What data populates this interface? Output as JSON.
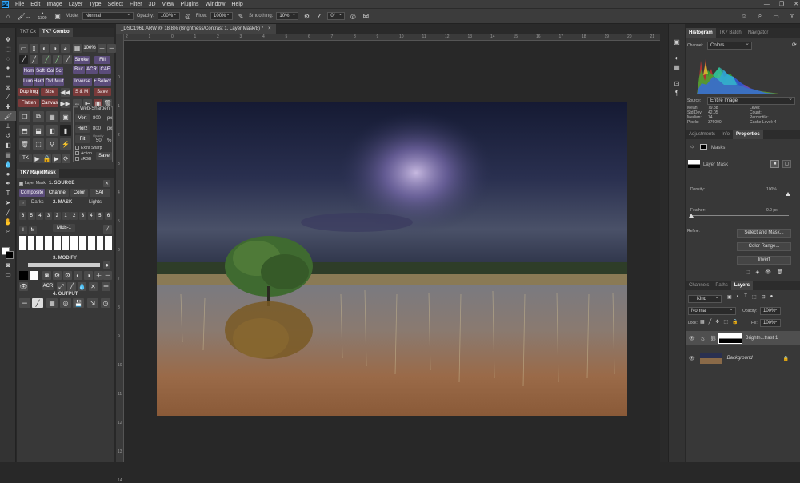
{
  "menu": [
    "File",
    "Edit",
    "Image",
    "Layer",
    "Type",
    "Select",
    "Filter",
    "3D",
    "View",
    "Plugins",
    "Window",
    "Help"
  ],
  "options": {
    "size": "1300",
    "mode_label": "Mode:",
    "mode_value": "Normal",
    "opacity_label": "Opacity:",
    "opacity_value": "100%",
    "flow_label": "Flow:",
    "flow_value": "100%",
    "smoothing_label": "Smoothing:",
    "smoothing_value": "10%",
    "angle_value": "0°"
  },
  "tk": {
    "tabs": [
      "TK7 Cx",
      "TK7 Combo"
    ],
    "zoom": "100%",
    "row1": [
      "Stroke",
      "Fill"
    ],
    "row2": [
      "Nom",
      "Soft",
      "Col",
      "Scr",
      "Blur",
      "ACR",
      "CAF"
    ],
    "row3": [
      "Lum",
      "Hard",
      "Ovl",
      "Mult",
      "Inverse",
      "± Select"
    ],
    "row4": [
      "Dup Img",
      "Size",
      "S & M",
      "Save"
    ],
    "row5": [
      "Flatten",
      "Canvas"
    ],
    "web_sharpen": "Web-Sharpen",
    "vert": "Vert",
    "vert_val": "800",
    "horz": "Horz",
    "horz_val": "800",
    "px": "px",
    "fit": "Fit",
    "opacity": "Opacity",
    "opacity_val": "50",
    "pct": "%",
    "checks": [
      "Extra Sharp",
      "Action",
      "sRGB"
    ],
    "save2": "Save",
    "tk": "TK",
    "rapidmask": "TK7 RapidMask",
    "layermask": "Layer Mask",
    "source": "1. SOURCE",
    "src_btns": [
      "Composite",
      "Channel",
      "Color",
      "SAT"
    ],
    "mask_hdr": "2. MASK",
    "darks": "Darks",
    "lights": "Lights",
    "mids": "Mids-1",
    "nums": [
      "6",
      "5",
      "4",
      "3",
      "2",
      "1",
      "2",
      "3",
      "4",
      "5",
      "6"
    ],
    "modify": "3. MODIFY",
    "acr": "ACR",
    "output": "4. OUTPUT"
  },
  "doc": {
    "title": "_DSC1961.ARW @ 18.8% (Brightness/Contrast 1, Layer Mask/8) *",
    "close": "×"
  },
  "ruler_h": [
    "2",
    "1",
    "0",
    "1",
    "2",
    "3",
    "4",
    "5",
    "6",
    "7",
    "8",
    "9",
    "10",
    "11",
    "12",
    "13",
    "14",
    "15",
    "16",
    "17",
    "18",
    "19",
    "20",
    "21"
  ],
  "ruler_v": [
    "0",
    "1",
    "2",
    "3",
    "4",
    "5",
    "6",
    "7",
    "8",
    "9",
    "10",
    "11",
    "12",
    "13",
    "14"
  ],
  "histogram": {
    "tabs": [
      "Histogram",
      "TK7 Batch",
      "Navigator"
    ],
    "channel_label": "Channel:",
    "channel": "Colors",
    "source_label": "Source:",
    "source": "Entire Image",
    "stats_left": [
      [
        "Mean:",
        "79.88"
      ],
      [
        "Std Dev:",
        "42.05"
      ],
      [
        "Median:",
        "74"
      ],
      [
        "Pixels:",
        "376000"
      ]
    ],
    "stats_right": [
      "Level:",
      "Count:",
      "Percentile:",
      "Cache Level: 4"
    ]
  },
  "props": {
    "tabs": [
      "Adjustments",
      "Info",
      "Properties"
    ],
    "mask_title": "Masks",
    "layer_mask": "Layer Mask",
    "density_label": "Density:",
    "density": "100%",
    "feather_label": "Feather:",
    "feather": "0.0 px",
    "refine": "Refine:",
    "btns": [
      "Select and Mask...",
      "Color Range...",
      "Invert"
    ]
  },
  "layers": {
    "tabs": [
      "Channels",
      "Paths",
      "Layers"
    ],
    "kind": "Kind",
    "blend": "Normal",
    "opacity_label": "Opacity:",
    "opacity": "100%",
    "lock_label": "Lock:",
    "fill_label": "Fill:",
    "fill": "100%",
    "items": [
      {
        "name": "Brightn...trast 1"
      },
      {
        "name": "Background"
      }
    ]
  }
}
